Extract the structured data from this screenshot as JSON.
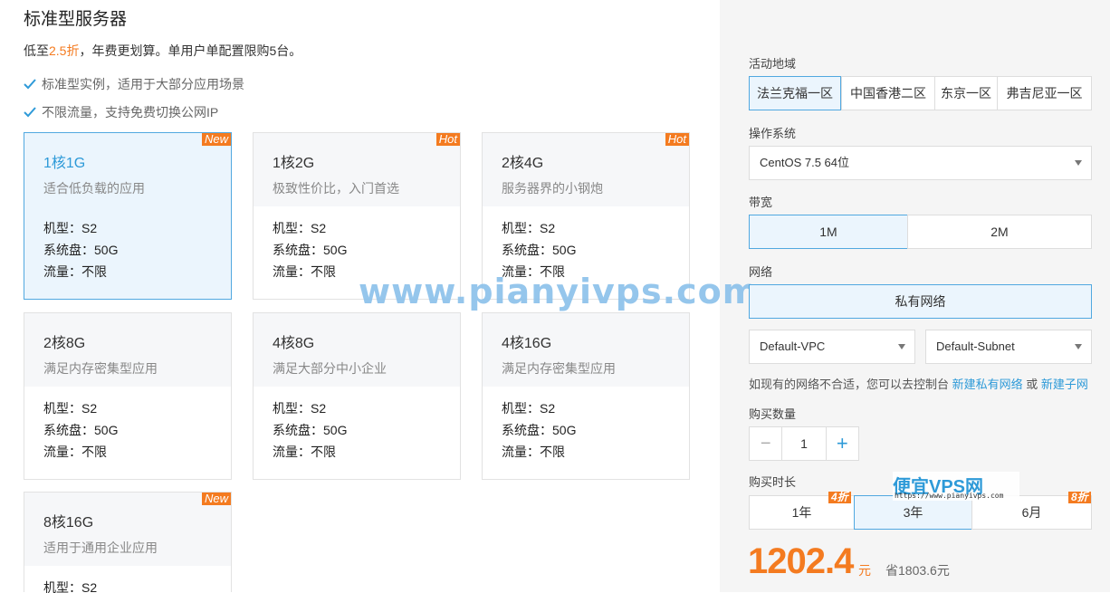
{
  "title": "标准型服务器",
  "promo": {
    "prefix": "低至",
    "discount": "2.5折",
    "suffix": "，年费更划算。单用户单配置限购5台。"
  },
  "features": [
    "标准型实例，适用于大部分应用场景",
    "不限流量，支持免费切换公网IP"
  ],
  "plans": [
    {
      "name": "1核1G",
      "desc": "适合低负载的应用",
      "badge": "New",
      "model": "机型：S2",
      "disk": "系统盘：50G",
      "traffic": "流量：不限"
    },
    {
      "name": "1核2G",
      "desc": "极致性价比，入门首选",
      "badge": "Hot",
      "model": "机型：S2",
      "disk": "系统盘：50G",
      "traffic": "流量：不限"
    },
    {
      "name": "2核4G",
      "desc": "服务器界的小钢炮",
      "badge": "Hot",
      "model": "机型：S2",
      "disk": "系统盘：50G",
      "traffic": "流量：不限"
    },
    {
      "name": "2核8G",
      "desc": "满足内存密集型应用",
      "badge": "",
      "model": "机型：S2",
      "disk": "系统盘：50G",
      "traffic": "流量：不限"
    },
    {
      "name": "4核8G",
      "desc": "满足大部分中小企业",
      "badge": "",
      "model": "机型：S2",
      "disk": "系统盘：50G",
      "traffic": "流量：不限"
    },
    {
      "name": "4核16G",
      "desc": "满足内存密集型应用",
      "badge": "",
      "model": "机型：S2",
      "disk": "系统盘：50G",
      "traffic": "流量：不限"
    },
    {
      "name": "8核16G",
      "desc": "适用于通用企业应用",
      "badge": "New",
      "model": "机型：S2",
      "disk": "",
      "traffic": ""
    }
  ],
  "watermark": "www.pianyivps.com",
  "region": {
    "label": "活动地域",
    "options": [
      "法兰克福一区",
      "中国香港二区",
      "东京一区",
      "弗吉尼亚一区"
    ]
  },
  "os": {
    "label": "操作系统",
    "value": "CentOS 7.5 64位"
  },
  "bandwidth": {
    "label": "带宽",
    "options": [
      "1M",
      "2M"
    ]
  },
  "network": {
    "label": "网络",
    "type": "私有网络",
    "vpc": "Default-VPC",
    "subnet": "Default-Subnet",
    "hint": "如现有的网络不合适，您可以去控制台 ",
    "link1": "新建私有网络",
    "or": " 或 ",
    "link2": "新建子网"
  },
  "quantity": {
    "label": "购买数量",
    "minus": "−",
    "value": "1",
    "plus": "+"
  },
  "duration": {
    "label": "购买时长",
    "options": [
      "1年",
      "3年",
      "6月"
    ],
    "badges": [
      "4折",
      "8折"
    ]
  },
  "price": {
    "amount": "1202.4",
    "unit": "元",
    "save": "省1803.6元"
  },
  "logo": {
    "text": "便宜VPS网",
    "url": "https://www.pianyivps.com"
  },
  "colors": {
    "accent": "#2e9ad8",
    "orange": "#f47b20",
    "selected_bg": "#ebf5fd"
  }
}
